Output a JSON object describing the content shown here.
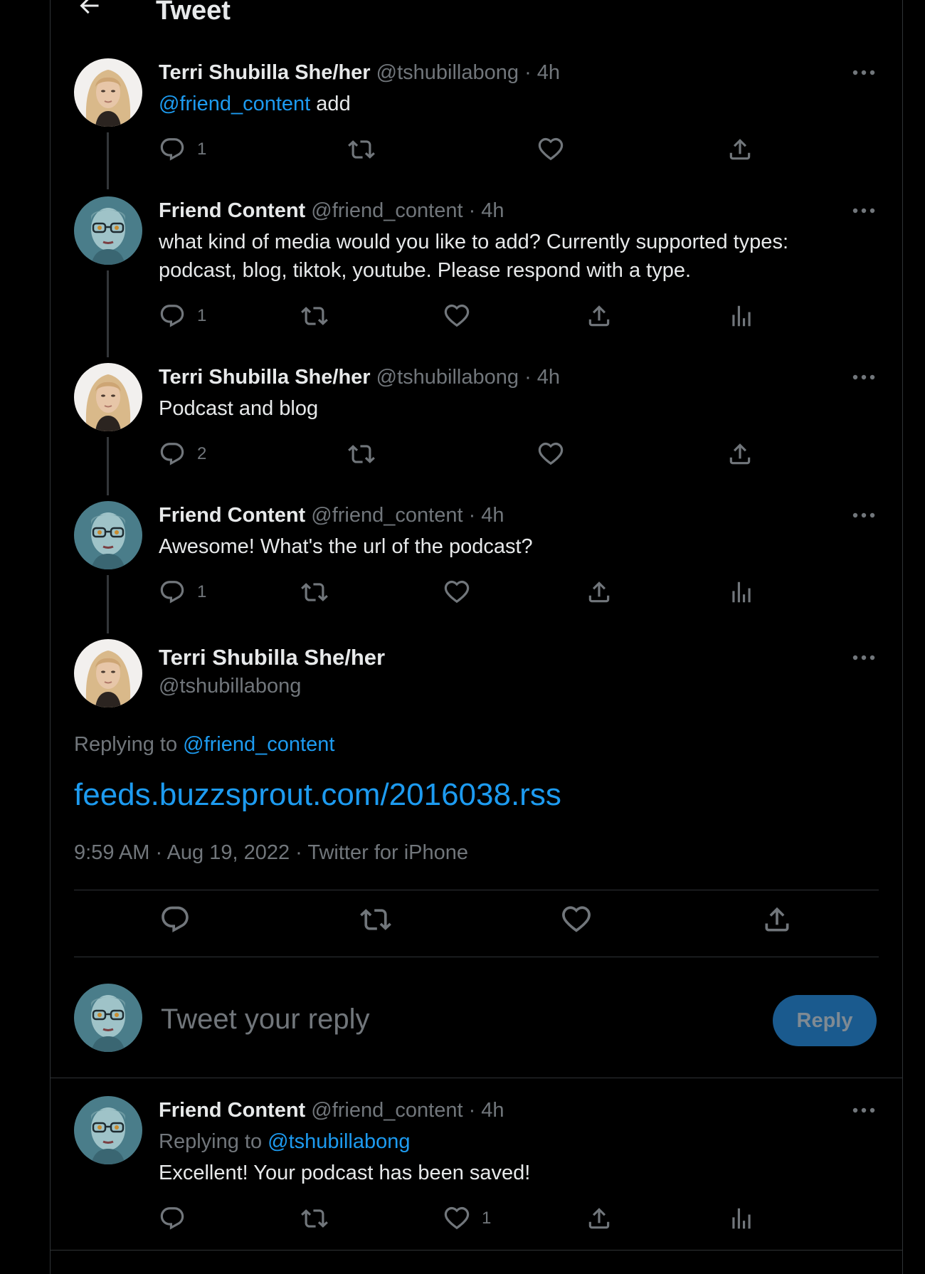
{
  "header": {
    "title": "Tweet"
  },
  "thread": [
    {
      "name": "Terri Shubilla She/her",
      "handle": "@tshubillabong",
      "time": "4h",
      "mention": "@friend_content",
      "text": " add",
      "avatar": "terri",
      "reply_count": "1",
      "like_count": "",
      "show_analytics": false
    },
    {
      "name": "Friend Content",
      "handle": "@friend_content",
      "time": "4h",
      "text": "what kind of media would you like to add? Currently supported types: podcast, blog, tiktok, youtube. Please respond with a type.",
      "avatar": "bot",
      "reply_count": "1",
      "show_analytics": true
    },
    {
      "name": "Terri Shubilla She/her",
      "handle": "@tshubillabong",
      "time": "4h",
      "text": "Podcast and blog",
      "avatar": "terri",
      "reply_count": "2",
      "show_analytics": false
    },
    {
      "name": "Friend Content",
      "handle": "@friend_content",
      "time": "4h",
      "text": "Awesome! What's the url of the podcast?",
      "avatar": "bot",
      "reply_count": "1",
      "show_analytics": true
    }
  ],
  "main_tweet": {
    "name": "Terri Shubilla She/her",
    "handle": "@tshubillabong",
    "replying_prefix": "Replying to ",
    "replying_to": "@friend_content",
    "text": "feeds.buzzsprout.com/2016038.rss",
    "timestamp": "9:59 AM · Aug 19, 2022 · Twitter for iPhone"
  },
  "composer": {
    "placeholder": "Tweet your reply",
    "button_label": "Reply"
  },
  "reply": {
    "name": "Friend Content",
    "handle": "@friend_content",
    "time": "4h",
    "replying_prefix": "Replying to ",
    "replying_to": "@tshubillabong",
    "text": "Excellent! Your podcast has been saved!",
    "like_count": "1"
  },
  "colors": {
    "background": "#000000",
    "accent": "#1d9bf0",
    "text": "#e7e9ea",
    "muted": "#71767b",
    "reply_button": "#1a5a8e"
  },
  "icons": [
    "back-arrow-icon",
    "more-icon",
    "reply-icon",
    "retweet-icon",
    "like-icon",
    "share-icon",
    "analytics-icon"
  ]
}
